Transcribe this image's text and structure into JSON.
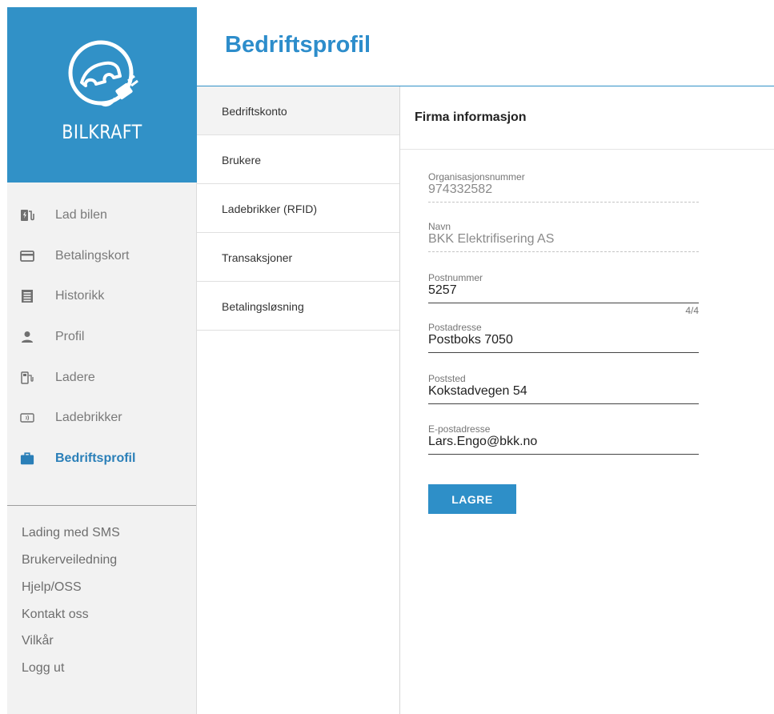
{
  "brand": {
    "name": "BILKRAFT"
  },
  "colors": {
    "accent": "#3191c7",
    "title": "#2d8dcb",
    "button": "#2e8fc8"
  },
  "nav": {
    "items": [
      {
        "label": "Lad bilen",
        "icon": "ev-charger-icon"
      },
      {
        "label": "Betalingskort",
        "icon": "credit-card-icon"
      },
      {
        "label": "Historikk",
        "icon": "history-list-icon"
      },
      {
        "label": "Profil",
        "icon": "person-icon"
      },
      {
        "label": "Ladere",
        "icon": "charger-station-icon"
      },
      {
        "label": "Ladebrikker",
        "icon": "rfid-tag-icon"
      },
      {
        "label": "Bedriftsprofil",
        "icon": "briefcase-icon",
        "active": true
      }
    ]
  },
  "footer": {
    "links": [
      "Lading med SMS",
      "Brukerveiledning",
      "Hjelp/OSS",
      "Kontakt oss",
      "Vilkår",
      "Logg ut"
    ]
  },
  "header": {
    "title": "Bedriftsprofil"
  },
  "submenu": {
    "items": [
      "Bedriftskonto",
      "Brukere",
      "Ladebrikker (RFID)",
      "Transaksjoner",
      "Betalingsløsning"
    ],
    "active_index": 0
  },
  "form": {
    "title": "Firma informasjon",
    "fields": [
      {
        "label": "Organisasjonsnummer",
        "value": "974332582",
        "disabled": true
      },
      {
        "label": "Navn",
        "value": "BKK Elektrifisering AS",
        "disabled": true
      },
      {
        "label": "Postnummer",
        "value": "5257",
        "counter": "4/4"
      },
      {
        "label": "Postadresse",
        "value": "Postboks 7050"
      },
      {
        "label": "Poststed",
        "value": "Kokstadvegen 54"
      },
      {
        "label": "E-postadresse",
        "value": "Lars.Engo@bkk.no"
      }
    ],
    "save_label": "LAGRE"
  }
}
